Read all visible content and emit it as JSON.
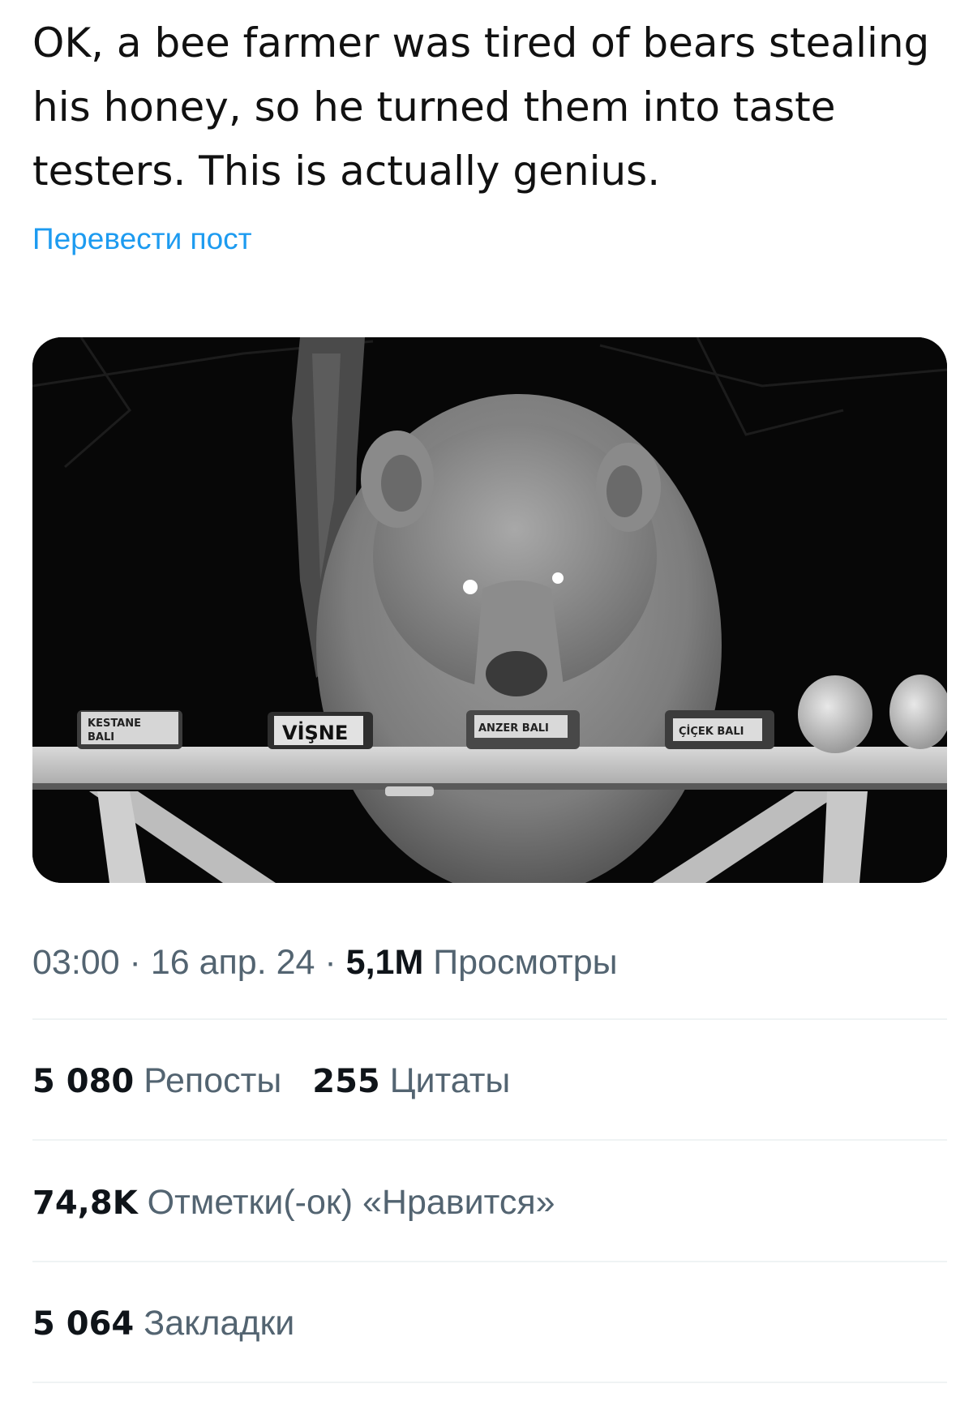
{
  "post": {
    "text": "OK, a bee farmer was tired of bears stealing his honey, so he turned them into taste testers. This is actually genius.",
    "translate_label": "Перевести пост"
  },
  "media": {
    "alt": "Night camera photo of a bear at a table tasting bowls of honey",
    "labels": {
      "bowl1_line1": "KESTANE",
      "bowl1_line2": "BALI",
      "bowl2": "VİŞNE",
      "bowl3": "ANZER BALI",
      "bowl4": "ÇİÇEK BALI"
    }
  },
  "meta": {
    "time": "03:00",
    "sep1": " · ",
    "date": "16 апр. 24",
    "sep2": " · ",
    "views_count": "5,1M",
    "views_label": "Просмотры"
  },
  "stats": {
    "reposts_count": "5 080",
    "reposts_label": "Репосты",
    "quotes_count": "255",
    "quotes_label": "Цитаты",
    "likes_count": "74,8K",
    "likes_label": "Отметки(-ок) «Нравится»",
    "bookmarks_count": "5 064",
    "bookmarks_label": "Закладки"
  },
  "colors": {
    "link": "#1d9bf0",
    "secondary_text": "#536471",
    "primary_text": "#0f1419",
    "divider": "#eff3f4"
  }
}
